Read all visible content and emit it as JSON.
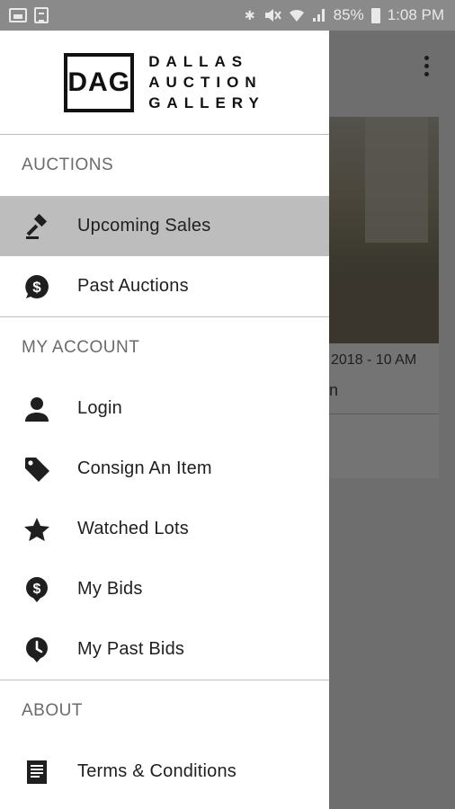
{
  "status_bar": {
    "bluetooth": "✱",
    "signal_text": "85%",
    "time": "1:08 PM"
  },
  "brand": {
    "mark": "DAG",
    "line1": "DALLAS",
    "line2": "AUCTION",
    "line3": "GALLERY"
  },
  "sections": {
    "auctions": {
      "header": "AUCTIONS",
      "items": [
        {
          "label": "Upcoming Sales",
          "icon": "gavel-icon"
        },
        {
          "label": "Past Auctions",
          "icon": "dollar-bubble-icon"
        }
      ]
    },
    "my_account": {
      "header": "MY ACCOUNT",
      "items": [
        {
          "label": "Login",
          "icon": "person-icon"
        },
        {
          "label": "Consign An Item",
          "icon": "tag-icon"
        },
        {
          "label": "Watched Lots",
          "icon": "star-icon"
        },
        {
          "label": "My Bids",
          "icon": "dollar-pin-icon"
        },
        {
          "label": "My Past Bids",
          "icon": "clock-pin-icon"
        }
      ]
    },
    "about": {
      "header": "ABOUT",
      "items": [
        {
          "label": "Terms & Conditions",
          "icon": "document-icon"
        }
      ]
    }
  },
  "background": {
    "card_date": "2018 - 10 AM",
    "card_title_fragment": "n"
  },
  "colors": {
    "active_item_bg": "#bdbdbd",
    "scrim": "#6e6e6e",
    "status_bar": "#8a8a8a"
  }
}
